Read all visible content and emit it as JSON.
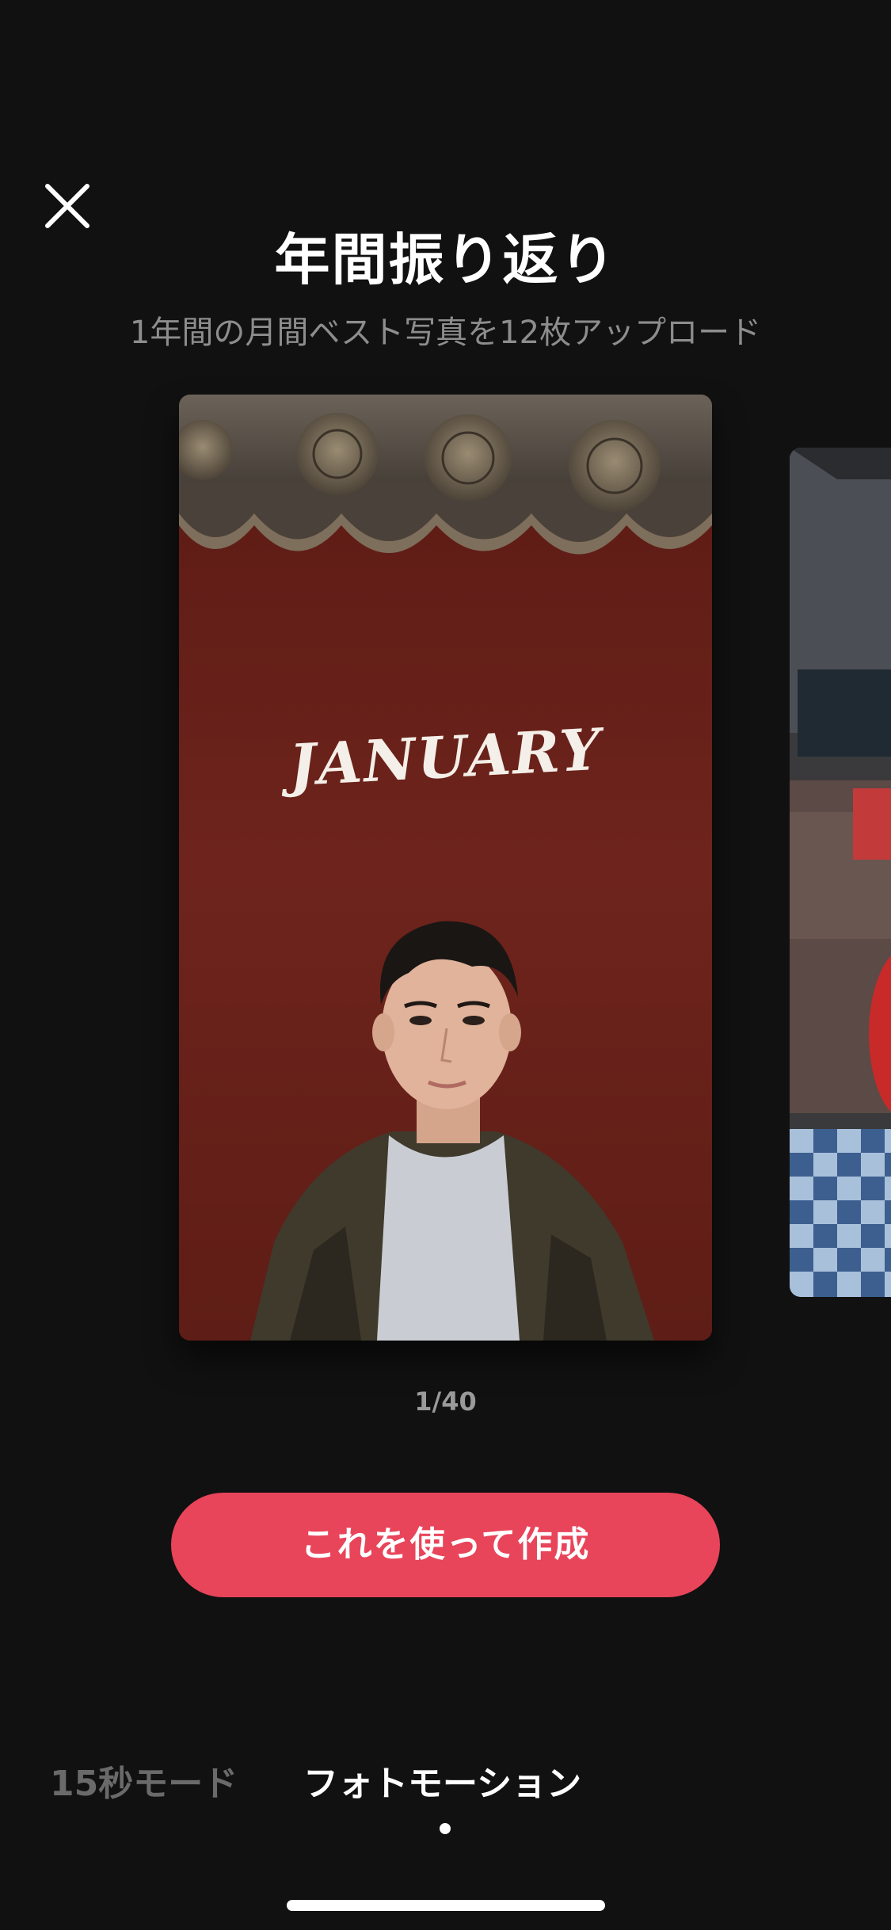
{
  "header": {
    "close_icon": "close-icon",
    "title": "年間振り返り",
    "subtitle": "1年間の月間ベスト写真を12枚アップロード"
  },
  "carousel": {
    "current_card": {
      "month_label": "JANUARY",
      "background_color": "#6d221b"
    },
    "page_indicator": "1/40"
  },
  "cta": {
    "label": "これを使って作成",
    "color": "#e8445a"
  },
  "mode_tabs": {
    "items": [
      {
        "label": "15秒モード",
        "selected": false
      },
      {
        "label": "フォトモーション",
        "selected": true
      }
    ]
  }
}
